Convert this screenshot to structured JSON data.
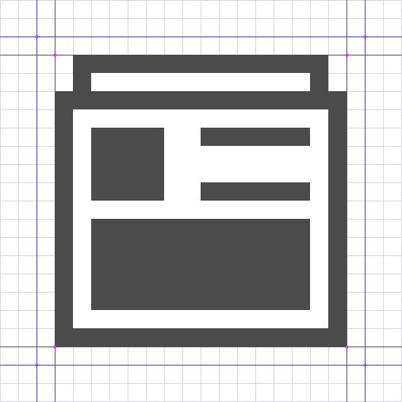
{
  "colors": {
    "background": "#ffffff",
    "minor_grid": "#d6d6f2",
    "major_grid": "#4a48c4",
    "guide_point": "#b24ac4",
    "icon_fill": "#4b4b4b",
    "icon_cutout": "#ffffff"
  },
  "icon": {
    "semantic_name": "newspaper-article-icon"
  }
}
